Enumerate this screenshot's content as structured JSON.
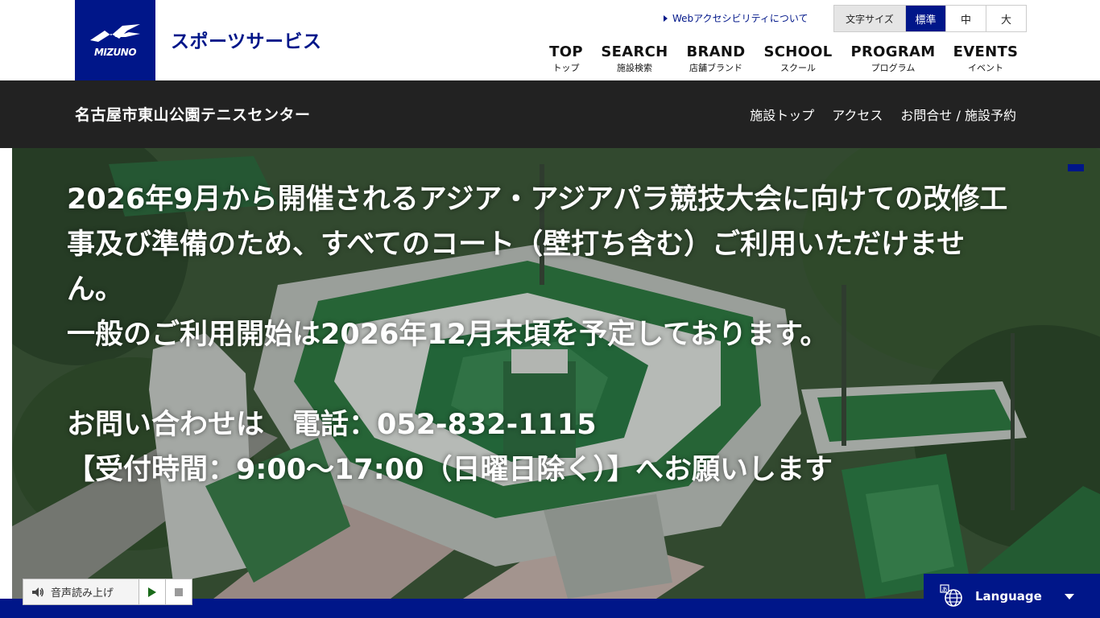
{
  "header": {
    "logo_text": "MIZUNO",
    "brand_name": "スポーツサービス",
    "accessibility_link": "Webアクセシビリティについて",
    "font_size": {
      "label": "文字サイズ",
      "options": [
        "標準",
        "中",
        "大"
      ],
      "selected": "標準"
    },
    "nav": [
      {
        "en": "TOP",
        "jp": "トップ"
      },
      {
        "en": "SEARCH",
        "jp": "施設検索"
      },
      {
        "en": "BRAND",
        "jp": "店舗ブランド"
      },
      {
        "en": "SCHOOL",
        "jp": "スクール"
      },
      {
        "en": "PROGRAM",
        "jp": "プログラム"
      },
      {
        "en": "EVENTS",
        "jp": "イベント"
      }
    ]
  },
  "subheader": {
    "facility_name": "名古屋市東山公園テニスセンター",
    "links": [
      "施設トップ",
      "アクセス",
      "お問合せ / 施設予約"
    ]
  },
  "hero": {
    "line1": "2026年9月から開催されるアジア・アジアパラ競技大会に向けての改修工",
    "line2": "事及び準備のため、すべてのコート（壁打ち含む）ご利用いただけませ",
    "line3": "ん。",
    "line4": "一般のご利用開始は2026年12月末頃を予定しております。",
    "line5": "",
    "line6": "お問い合わせは　電話：052-832-1115",
    "line7": "【受付時間：9:00～17:00（日曜日除く）】へお願いします"
  },
  "tts": {
    "label": "音声読み上げ"
  },
  "language": {
    "label": "Language"
  },
  "colors": {
    "brand_blue": "#001689",
    "subbar_bg": "#222222"
  }
}
